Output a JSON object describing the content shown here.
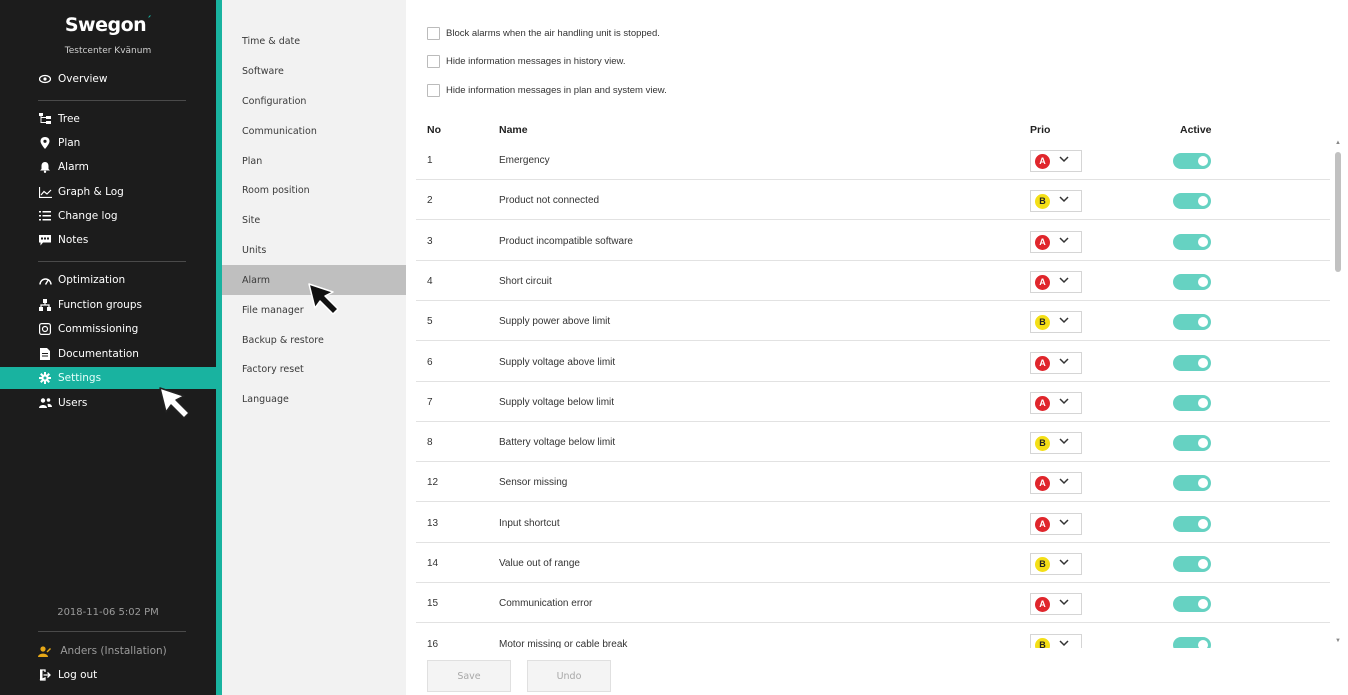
{
  "sidebar": {
    "brand": "Swegon",
    "site_name": "Testcenter Kvänum",
    "groups": [
      [
        {
          "label": "Overview",
          "icon": "eye-icon"
        }
      ],
      [
        {
          "label": "Tree",
          "icon": "tree-icon"
        },
        {
          "label": "Plan",
          "icon": "map-pin-icon"
        },
        {
          "label": "Alarm",
          "icon": "bell-icon"
        },
        {
          "label": "Graph & Log",
          "icon": "graph-icon"
        },
        {
          "label": "Change log",
          "icon": "list-icon"
        },
        {
          "label": "Notes",
          "icon": "note-icon"
        }
      ],
      [
        {
          "label": "Optimization",
          "icon": "gauge-icon"
        },
        {
          "label": "Function groups",
          "icon": "hierarchy-icon"
        },
        {
          "label": "Commissioning",
          "icon": "commissioning-icon"
        },
        {
          "label": "Documentation",
          "icon": "document-icon"
        },
        {
          "label": "Settings",
          "icon": "gear-icon",
          "active": true
        },
        {
          "label": "Users",
          "icon": "users-icon"
        }
      ]
    ],
    "datetime": "2018-11-06 5:02 PM",
    "user": "Anders (Installation)",
    "logout": "Log out"
  },
  "submenu": {
    "items": [
      "Time & date",
      "Software",
      "Configuration",
      "Communication",
      "Plan",
      "Room position",
      "Site",
      "Units",
      "Alarm",
      "File manager",
      "Backup & restore",
      "Factory reset",
      "Language"
    ],
    "active": "Alarm"
  },
  "options": [
    {
      "label": "Block alarms when the air handling unit is stopped.",
      "checked": false
    },
    {
      "label": "Hide information messages in history view.",
      "checked": false
    },
    {
      "label": "Hide information messages in plan and system view.",
      "checked": false
    }
  ],
  "table": {
    "headers": {
      "no": "No",
      "name": "Name",
      "prio": "Prio",
      "active": "Active"
    },
    "rows": [
      {
        "no": "1",
        "name": "Emergency",
        "prio": "A",
        "active": true
      },
      {
        "no": "2",
        "name": "Product not connected",
        "prio": "B",
        "active": true
      },
      {
        "no": "3",
        "name": "Product incompatible software",
        "prio": "A",
        "active": true
      },
      {
        "no": "4",
        "name": "Short circuit",
        "prio": "A",
        "active": true
      },
      {
        "no": "5",
        "name": "Supply power above limit",
        "prio": "B",
        "active": true
      },
      {
        "no": "6",
        "name": "Supply voltage above limit",
        "prio": "A",
        "active": true
      },
      {
        "no": "7",
        "name": "Supply voltage below limit",
        "prio": "A",
        "active": true
      },
      {
        "no": "8",
        "name": "Battery voltage below limit",
        "prio": "B",
        "active": true
      },
      {
        "no": "12",
        "name": "Sensor missing",
        "prio": "A",
        "active": true
      },
      {
        "no": "13",
        "name": "Input shortcut",
        "prio": "A",
        "active": true
      },
      {
        "no": "14",
        "name": "Value out of range",
        "prio": "B",
        "active": true
      },
      {
        "no": "15",
        "name": "Communication error",
        "prio": "A",
        "active": true
      },
      {
        "no": "16",
        "name": "Motor missing or cable break",
        "prio": "B",
        "active": true
      }
    ]
  },
  "buttons": {
    "save": "Save",
    "undo": "Undo"
  },
  "colors": {
    "accent": "#19b3a0",
    "toggle_on": "#66d2c2",
    "prio_a": "#e0262c",
    "prio_b": "#f4df17"
  }
}
